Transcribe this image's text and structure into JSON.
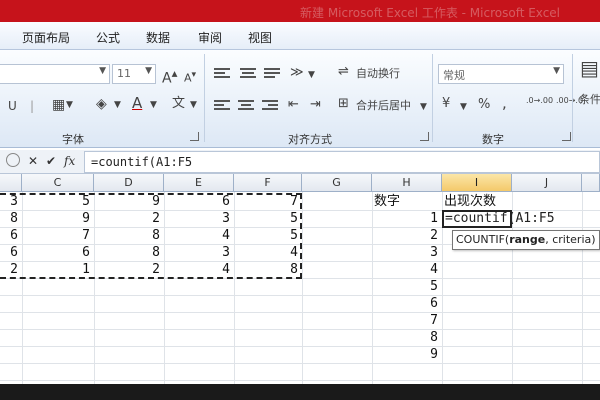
{
  "window": {
    "title": "新建 Microsoft Excel 工作表 - Microsoft Excel"
  },
  "tabs": [
    "页面布局",
    "公式",
    "数据",
    "审阅",
    "视图"
  ],
  "ribbon": {
    "font_size": "11",
    "font_grow": "A",
    "font_shrink": "A",
    "wrap_text": "自动换行",
    "merge_center": "合并后居中",
    "number_format": "常规",
    "percent": "%",
    "comma": ",",
    "increase_decimal": ".0→.00",
    "decrease_decimal": ".00→.0",
    "conditional": "条件",
    "groups": {
      "font": "字体",
      "align": "对齐方式",
      "number": "数字"
    }
  },
  "formula_bar": {
    "cancel": "✕",
    "enter": "✔",
    "fx": "fx",
    "value": "=countif(A1:F5"
  },
  "columns": [
    "C",
    "D",
    "E",
    "F",
    "G",
    "H",
    "I",
    "J"
  ],
  "selected_column": "I",
  "grid": {
    "rows": [
      [
        "3",
        "5",
        "9",
        "6",
        "7"
      ],
      [
        "8",
        "9",
        "2",
        "3",
        "5"
      ],
      [
        "6",
        "7",
        "8",
        "4",
        "5"
      ],
      [
        "6",
        "6",
        "8",
        "3",
        "4"
      ],
      [
        "2",
        "1",
        "2",
        "4",
        "8"
      ]
    ],
    "h_header": "数字",
    "i_header": "出现次数",
    "h_values": [
      "1",
      "2",
      "3",
      "4",
      "5",
      "6",
      "7",
      "8",
      "9"
    ]
  },
  "editing": {
    "cell_text": "=countif(A1:F5",
    "tooltip_fn": "COUNTIF(",
    "tooltip_arg1": "range",
    "tooltip_rest": ", criteria)"
  },
  "colors": {
    "title_bar": "#c6131b",
    "selected_header": "#f4c96a"
  }
}
